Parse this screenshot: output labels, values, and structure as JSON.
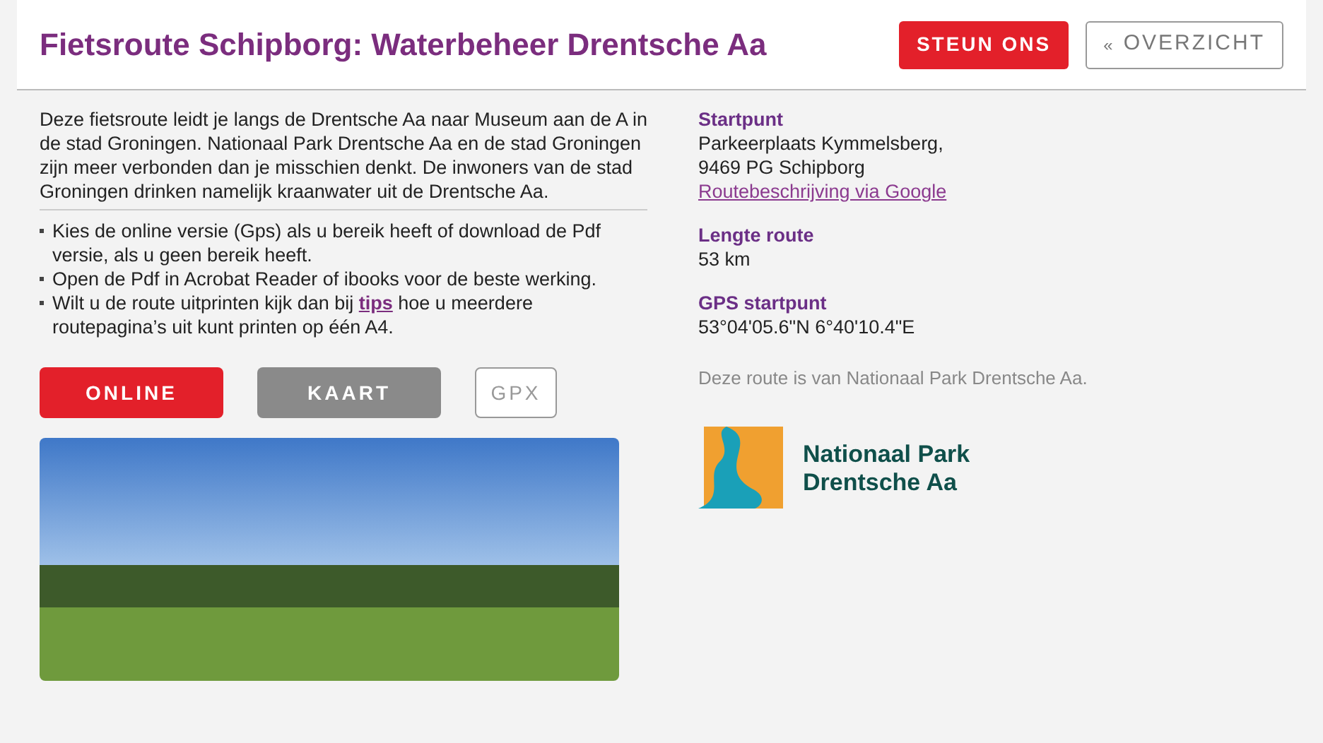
{
  "header": {
    "title": "Fietsroute Schipborg: Waterbeheer Drentsche Aa",
    "buttons": [
      {
        "label": "STEUN ONS",
        "kind": "primary"
      },
      {
        "label": "OVERZICHT",
        "kind": "back",
        "icon": "«"
      }
    ]
  },
  "intro": "Deze fietsroute leidt je langs de Drentsche Aa naar Museum aan de A in de stad Groningen. Nationaal Park Drentsche Aa en de stad Groningen zijn meer verbonden dan je misschien denkt. De inwoners van de stad Groningen drinken namelijk kraanwater uit de Drentsche Aa.",
  "tips": [
    {
      "text": "Kies de online versie (Gps) als u bereik heeft of download de Pdf versie, als u geen bereik heeft."
    },
    {
      "text": "Open de Pdf in Acrobat Reader of ibooks voor de beste werking."
    },
    {
      "text": "Wilt u de route uitprinten kijk dan bij",
      "link": "tips",
      "after": "hoe u meerdere routepagina’s uit kunt printen op één A4."
    }
  ],
  "actions": [
    {
      "label": "ONLINE",
      "kind": "primary"
    },
    {
      "label": "KAART",
      "kind": "secondary"
    },
    {
      "label": "GPX",
      "kind": "outline"
    }
  ],
  "details": [
    {
      "heading": "Startpunt",
      "lines": [
        "Parkeerplaats Kymmelsberg,",
        "9469 PG Schipborg"
      ],
      "link": "Routebeschrijving via Google"
    },
    {
      "heading": "Lengte route",
      "lines": [
        "53 km"
      ]
    },
    {
      "heading": "GPS startpunt",
      "lines": [
        "53°04'05.6\"N 6°40'10.4\"E"
      ]
    }
  ],
  "owner_note": "Deze route is van Nationaal Park Drentsche Aa.",
  "logo": {
    "lines": [
      "Nationaal Park",
      "Drentsche Aa"
    ]
  }
}
